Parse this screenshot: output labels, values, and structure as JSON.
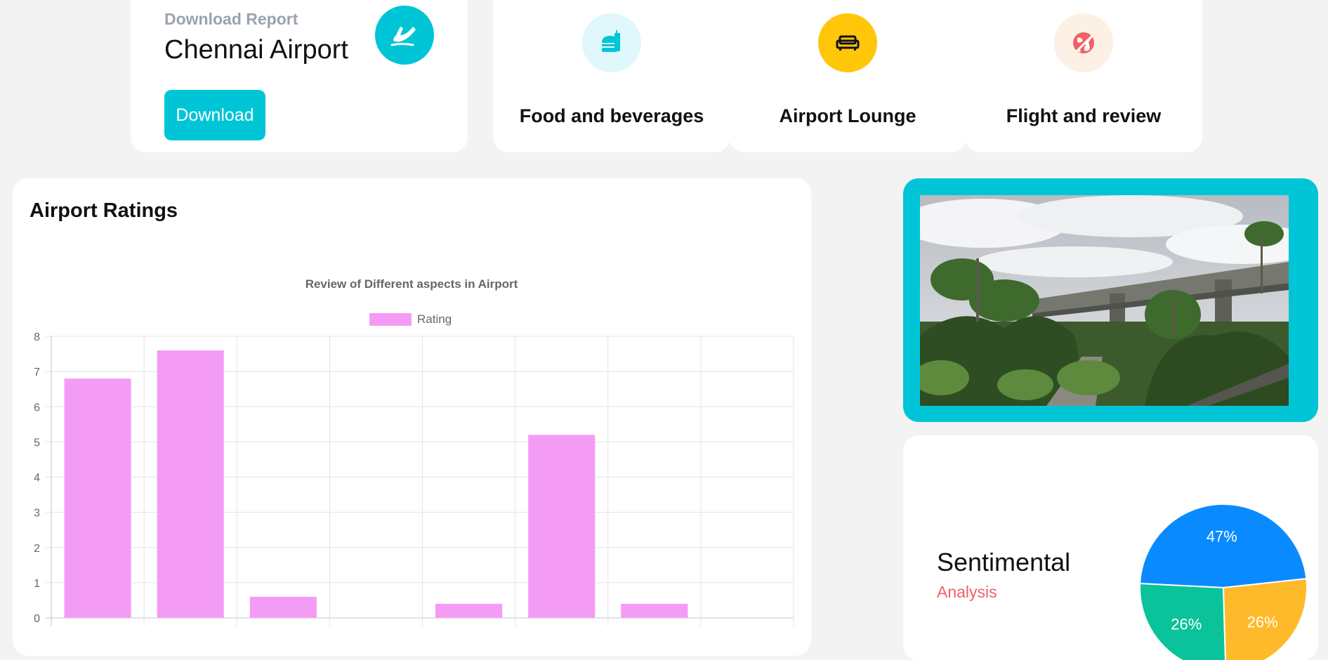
{
  "download_card": {
    "subtitle": "Download Report",
    "title": "Chennai Airport",
    "button_label": "Download",
    "icon": "plane-takeoff-icon",
    "accent": "#00c5d7"
  },
  "categories": [
    {
      "label": "Food and beverages",
      "icon": "fast-food-icon",
      "icon_color": "#00c5d7",
      "icon_bg": "#e0f8fb"
    },
    {
      "label": "Airport Lounge",
      "icon": "couch-icon",
      "icon_color": "#111111",
      "icon_bg": "#ffc60a"
    },
    {
      "label": "Flight and review",
      "icon": "globe-plane-icon",
      "icon_color": "#f0606a",
      "icon_bg": "#fdf0e5"
    }
  ],
  "ratings": {
    "heading": "Airport Ratings"
  },
  "chart_data": [
    {
      "type": "bar",
      "title": "Review of Different aspects in Airport",
      "legend_position": "top",
      "grid": true,
      "ylim": [
        0,
        8
      ],
      "yticks": [
        0,
        1,
        2,
        3,
        4,
        5,
        6,
        7,
        8
      ],
      "categories": [
        "",
        "",
        "",
        "",
        "",
        "",
        "",
        ""
      ],
      "series": [
        {
          "name": "Rating",
          "values": [
            6.8,
            7.6,
            0.6,
            0,
            0.4,
            5.2,
            0.4,
            0
          ],
          "color": "#f49cf5"
        }
      ]
    },
    {
      "type": "pie",
      "categories": [
        "",
        "",
        ""
      ],
      "values": [
        47,
        26,
        26
      ],
      "labels": [
        "47%",
        "26%",
        "26%"
      ],
      "colors": [
        "#0a8aff",
        "#0ac39a",
        "#ffba2b"
      ]
    }
  ],
  "sentiment": {
    "title": "Sentimental",
    "subtitle": "Analysis"
  }
}
